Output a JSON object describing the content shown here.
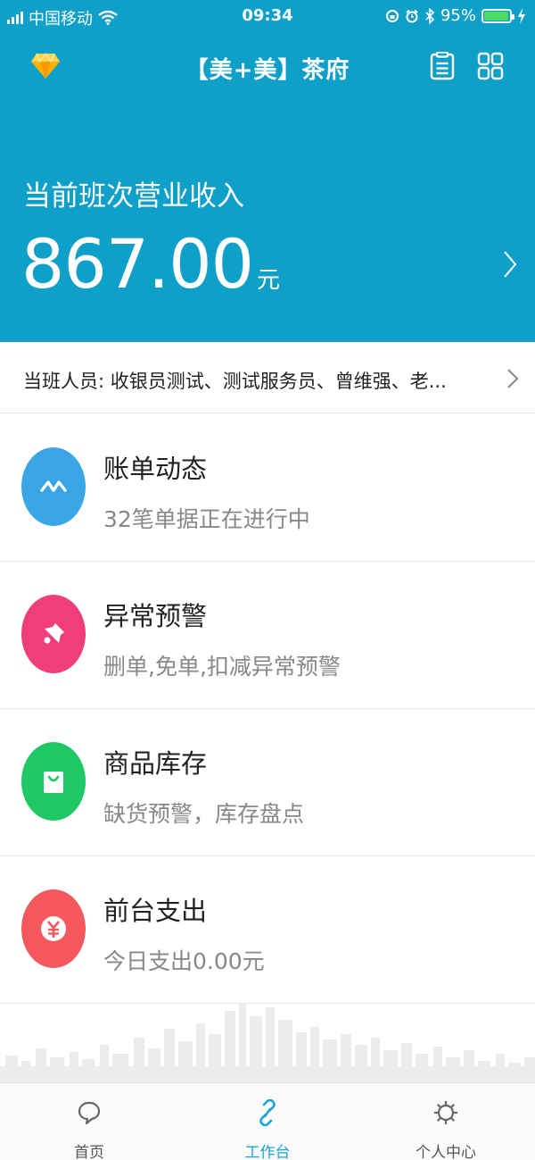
{
  "status_bar": {
    "carrier": "中国移动",
    "time": "09:34",
    "battery": "95%",
    "battery_level": 0.95,
    "battery_color": "#4cd964"
  },
  "header": {
    "left_icon": "diamond-icon",
    "title": "【美+美】茶府",
    "right_icons": [
      "clipboard-icon",
      "grid-icon"
    ],
    "background": "#0ea0c9"
  },
  "revenue": {
    "label": "当前班次营业收入",
    "value": "867.00",
    "unit": "元"
  },
  "staff": {
    "text": "当班人员: 收银员测试、测试服务员、曾维强、老..."
  },
  "modules": [
    {
      "title": "账单动态",
      "desc": "32笔单据正在进行中",
      "icon": "pulse-icon",
      "color": "#3aa6e6"
    },
    {
      "title": "异常预警",
      "desc": "删单,免单,扣减异常预警",
      "icon": "bell-icon",
      "color": "#f03e7a"
    },
    {
      "title": "商品库存",
      "desc": "缺货预警，库存盘点",
      "icon": "shopping-bag-icon",
      "color": "#1ec864"
    },
    {
      "title": "前台支出",
      "desc": "今日支出0.00元",
      "icon": "yen-icon",
      "color": "#f4585d"
    }
  ],
  "tabs": [
    {
      "label": "首页",
      "icon": "chat-bubble-icon",
      "active": false
    },
    {
      "label": "工作台",
      "icon": "link-icon",
      "active": true
    },
    {
      "label": "个人中心",
      "icon": "gear-icon",
      "active": false
    }
  ],
  "accent_color": "#1aa3d6"
}
